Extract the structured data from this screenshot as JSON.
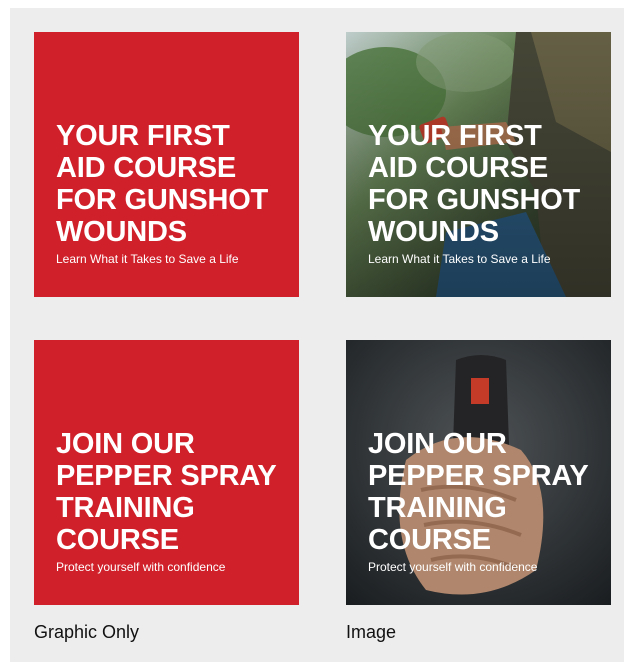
{
  "cards": {
    "first_aid": {
      "headline": "YOUR FIRST\nAID COURSE\nFOR GUNSHOT\nWOUNDS",
      "subtitle": "Learn What it Takes to Save a Life"
    },
    "pepper": {
      "headline": "JOIN OUR\nPEPPER SPRAY\nTRAINING\nCOURSE",
      "subtitle": "Protect yourself with confidence"
    }
  },
  "captions": {
    "graphic": "Graphic Only",
    "image": "Image"
  },
  "colors": {
    "brand_red": "#d0202a",
    "panel_bg": "#ededed"
  },
  "icons": {
    "photo_1": "hiker-with-red-phone-photo",
    "photo_2": "hand-holding-pepper-spray-photo"
  }
}
